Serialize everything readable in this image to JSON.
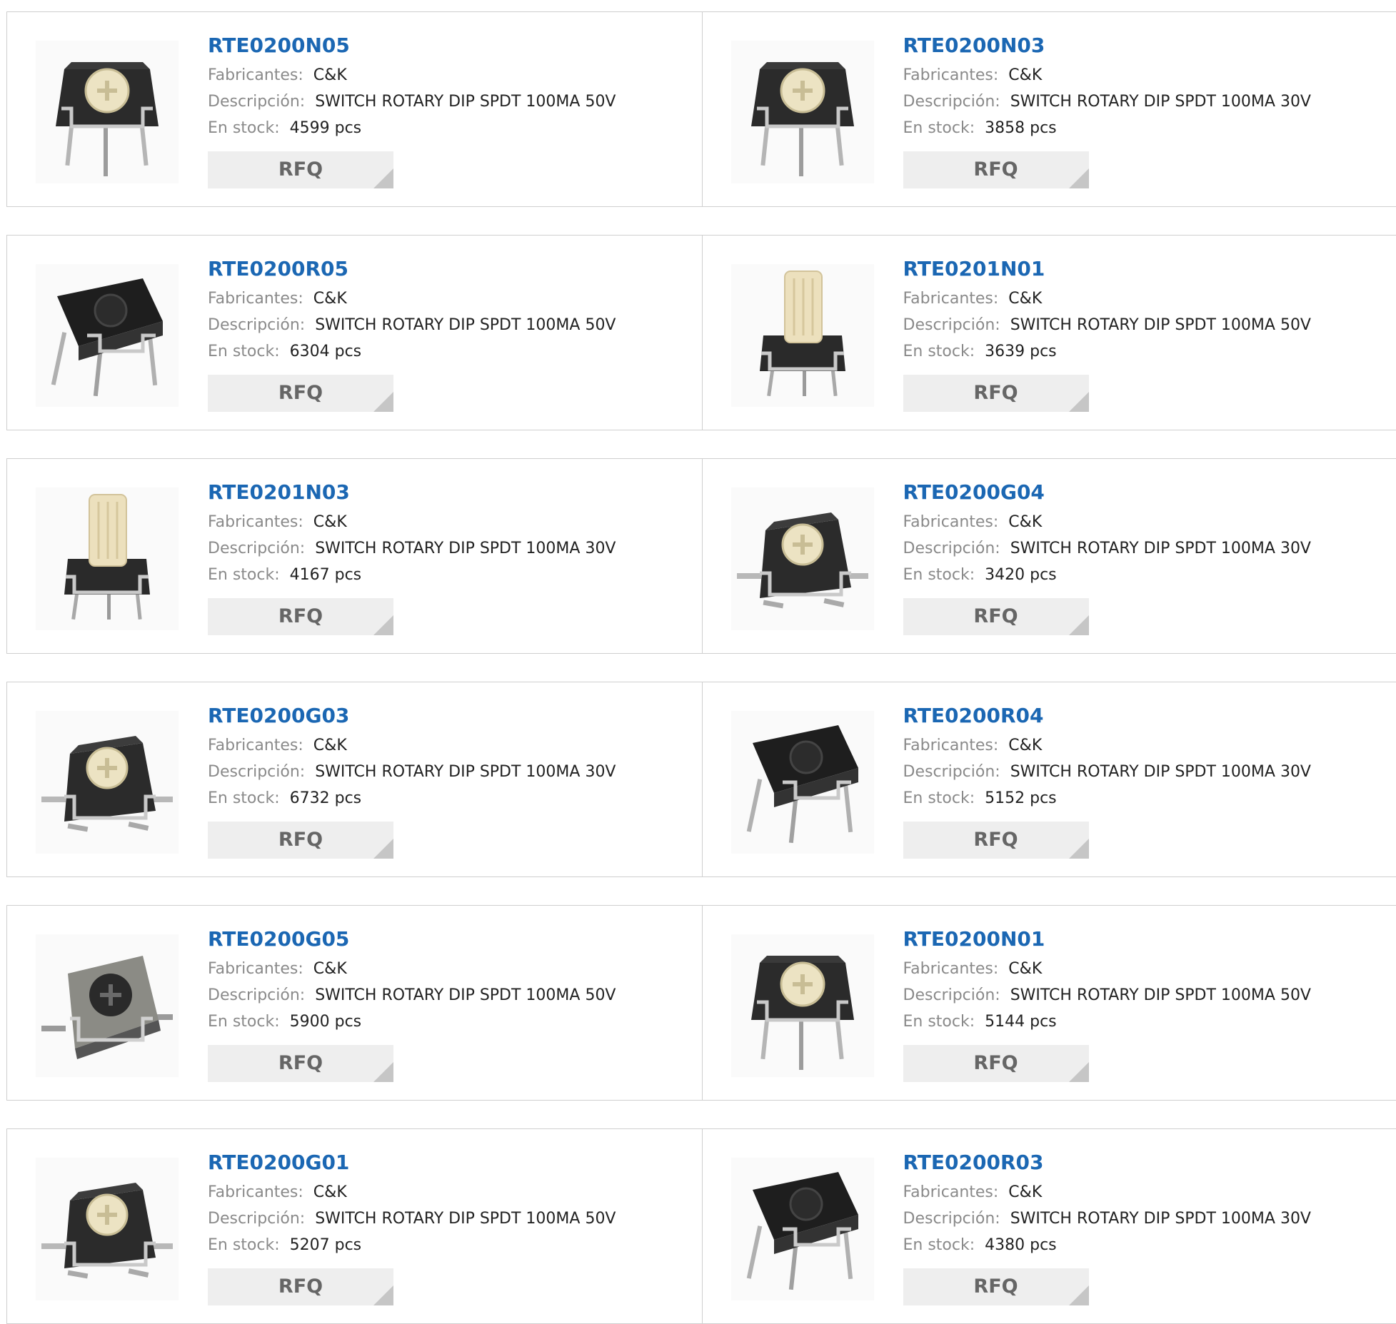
{
  "labels": {
    "manufacturer": "Fabricantes:",
    "description": "Descripción:",
    "stock": "En stock:",
    "rfq": "RFQ"
  },
  "products": [
    {
      "name": "RTE0200N05",
      "manufacturer": "C&K",
      "description": "SWITCH ROTARY DIP SPDT 100MA 50V",
      "stock": "4599 pcs",
      "image": "switch-top-knob-icon"
    },
    {
      "name": "RTE0200N03",
      "manufacturer": "C&K",
      "description": "SWITCH ROTARY DIP SPDT 100MA 30V",
      "stock": "3858 pcs",
      "image": "switch-top-knob-icon"
    },
    {
      "name": "RTE0200R05",
      "manufacturer": "C&K",
      "description": "SWITCH ROTARY DIP SPDT 100MA 50V",
      "stock": "6304 pcs",
      "image": "switch-black-side-icon"
    },
    {
      "name": "RTE0201N01",
      "manufacturer": "C&K",
      "description": "SWITCH ROTARY DIP SPDT 100MA 50V",
      "stock": "3639 pcs",
      "image": "switch-shaft-icon"
    },
    {
      "name": "RTE0201N03",
      "manufacturer": "C&K",
      "description": "SWITCH ROTARY DIP SPDT 100MA 30V",
      "stock": "4167 pcs",
      "image": "switch-shaft-icon"
    },
    {
      "name": "RTE0200G04",
      "manufacturer": "C&K",
      "description": "SWITCH ROTARY DIP SPDT 100MA 30V",
      "stock": "3420 pcs",
      "image": "switch-smd-knob-icon"
    },
    {
      "name": "RTE0200G03",
      "manufacturer": "C&K",
      "description": "SWITCH ROTARY DIP SPDT 100MA 30V",
      "stock": "6732 pcs",
      "image": "switch-smd-knob-icon"
    },
    {
      "name": "RTE0200R04",
      "manufacturer": "C&K",
      "description": "SWITCH ROTARY DIP SPDT 100MA 30V",
      "stock": "5152 pcs",
      "image": "switch-black-side-icon"
    },
    {
      "name": "RTE0200G05",
      "manufacturer": "C&K",
      "description": "SWITCH ROTARY DIP SPDT 100MA 50V",
      "stock": "5900 pcs",
      "image": "switch-smd-gray-icon"
    },
    {
      "name": "RTE0200N01",
      "manufacturer": "C&K",
      "description": "SWITCH ROTARY DIP SPDT 100MA 50V",
      "stock": "5144 pcs",
      "image": "switch-top-knob-icon"
    },
    {
      "name": "RTE0200G01",
      "manufacturer": "C&K",
      "description": "SWITCH ROTARY DIP SPDT 100MA 50V",
      "stock": "5207 pcs",
      "image": "switch-smd-knob-icon"
    },
    {
      "name": "RTE0200R03",
      "manufacturer": "C&K",
      "description": "SWITCH ROTARY DIP SPDT 100MA 30V",
      "stock": "4380 pcs",
      "image": "switch-black-side-icon"
    }
  ]
}
